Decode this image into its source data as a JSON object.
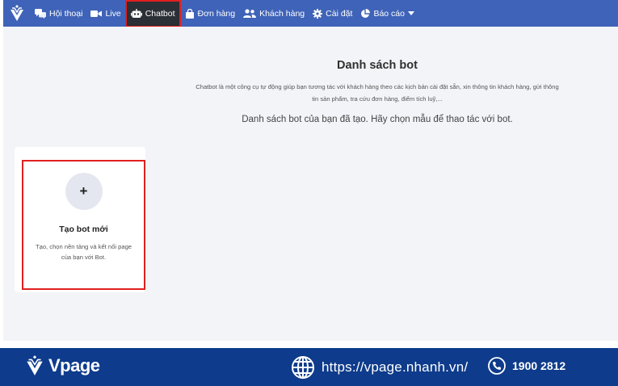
{
  "nav": {
    "items": [
      {
        "id": "conversations",
        "label": "Hội thoại",
        "icon": "chat-bubbles-icon"
      },
      {
        "id": "live",
        "label": "Live",
        "icon": "video-camera-icon"
      },
      {
        "id": "chatbot",
        "label": "Chatbot",
        "icon": "robot-icon",
        "active": true
      },
      {
        "id": "orders",
        "label": "Đơn hàng",
        "icon": "shopping-bag-icon"
      },
      {
        "id": "customers",
        "label": "Khách hàng",
        "icon": "users-icon"
      },
      {
        "id": "settings",
        "label": "Cài đặt",
        "icon": "gear-icon"
      },
      {
        "id": "reports",
        "label": "Báo cáo",
        "icon": "pie-chart-icon",
        "dropdown": true
      }
    ]
  },
  "main": {
    "title": "Danh sách bot",
    "description": "Chatbot là một công cụ tự động giúp bạn tương tác với khách hàng theo các kịch bản cài đặt sẵn, xin thông tin khách hàng, gửi thông tin sản phẩm, tra cứu đơn hàng, điểm tích luỹ,...",
    "subtitle": "Danh sách bot của bạn đã tạo. Hãy chọn mẫu để thao tác với bot.",
    "create_card": {
      "plus": "+",
      "title": "Tạo bot mới",
      "description": "Tạo, chọn nền tảng và kết nối page của bạn với Bot."
    }
  },
  "footer": {
    "brand": "Vpage",
    "website": "https://vpage.nhanh.vn/",
    "phone": "1900 2812"
  },
  "colors": {
    "nav_bg": "#3f63b8",
    "active_bg": "#2b2f36",
    "highlight": "#e02020",
    "footer_bg": "#0e3b8b",
    "page_bg": "#f3f4f8"
  }
}
